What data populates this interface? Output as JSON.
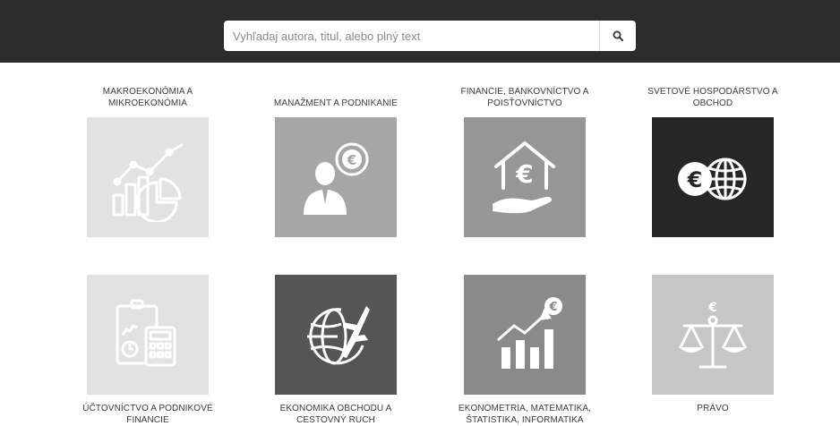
{
  "header": {
    "search_placeholder": "Vyhľadaj autora, titul, alebo plný text"
  },
  "categories": [
    {
      "label": "MAKROEKONÓMIA A MIKROEKONÓMIA",
      "icon": "chart-growth-icon",
      "tile_color": "#e2e2e2"
    },
    {
      "label": "MANAŽMENT A PODNIKANIE",
      "icon": "businessman-euro-icon",
      "tile_color": "#a6a6a6"
    },
    {
      "label": "FINANCIE, BANKOVNÍCTVO A POISŤOVNÍCTVO",
      "icon": "house-euro-hand-icon",
      "tile_color": "#969696"
    },
    {
      "label": "SVETOVÉ HOSPODÁRSTVO A OBCHOD",
      "icon": "euro-globe-icon",
      "tile_color": "#262626"
    },
    {
      "label": "ÚČTOVNÍCTVO A PODNIKOVÉ FINANCIE",
      "icon": "accounting-calculator-icon",
      "tile_color": "#e2e2e2"
    },
    {
      "label": "EKONOMIKA OBCHODU A CESTOVNÝ RUCH",
      "icon": "globe-airplane-icon",
      "tile_color": "#555555"
    },
    {
      "label": "EKONOMETRIA, MATEMATIKA, ŠTATISTIKA, INFORMATIKA",
      "icon": "bar-chart-euro-icon",
      "tile_color": "#8a8a8a"
    },
    {
      "label": "PRÁVO",
      "icon": "scales-justice-icon",
      "tile_color": "#c6c6c6"
    }
  ]
}
